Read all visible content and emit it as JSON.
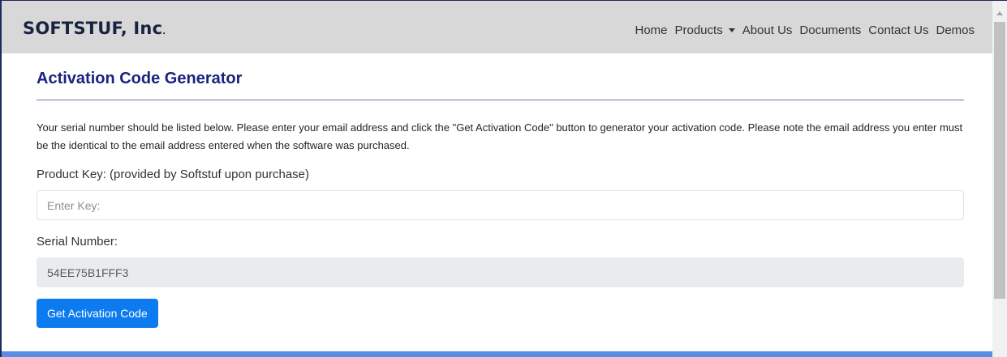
{
  "brand": {
    "name": "SOFTSTUF, Inc",
    "dot": "."
  },
  "nav": {
    "items": [
      {
        "label": "Home"
      },
      {
        "label": "Products",
        "dropdown": true
      },
      {
        "label": "About Us"
      },
      {
        "label": "Documents"
      },
      {
        "label": "Contact Us"
      },
      {
        "label": "Demos"
      }
    ]
  },
  "page": {
    "title": "Activation Code Generator",
    "intro": "Your serial number should be listed below. Please enter your email address and click the \"Get Activation Code\" button to generator your activation code. Please note the email address you enter must be the identical to the email address entered when the software was purchased."
  },
  "form": {
    "product_key": {
      "label": "Product Key: (provided by Softstuf upon purchase)",
      "value": "",
      "placeholder": "Enter Key:"
    },
    "serial_number": {
      "label": "Serial Number:",
      "value": "54EE75B1FFF3"
    },
    "submit_label": "Get Activation Code"
  },
  "colors": {
    "navbar_bg": "#d8d8d8",
    "title": "#1a237e",
    "button": "#0d7bf0",
    "footer_bar": "#5a8ee6"
  }
}
